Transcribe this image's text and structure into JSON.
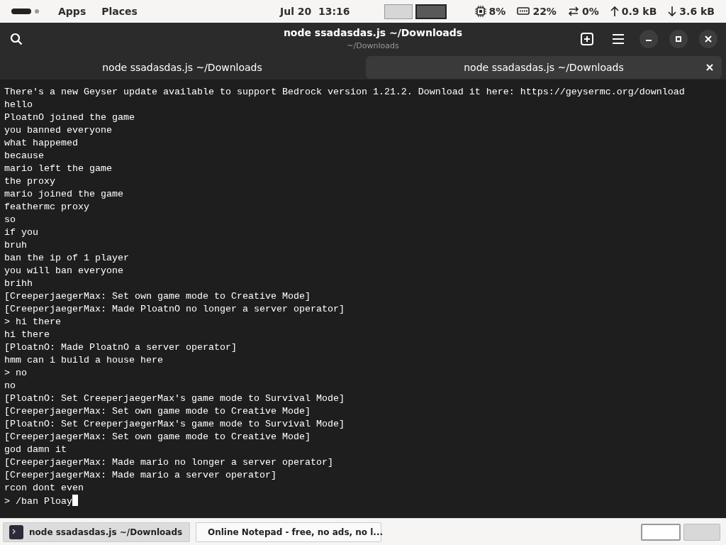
{
  "top_bar": {
    "menus": [
      "Apps",
      "Places"
    ],
    "clock": "Jul 20  13:16",
    "workspaces": [
      {
        "selected": false
      },
      {
        "selected": true
      }
    ],
    "indicators": [
      {
        "kind": "cpu",
        "text": "8%"
      },
      {
        "kind": "memory",
        "text": "22%"
      },
      {
        "kind": "swap",
        "text": "0%"
      },
      {
        "kind": "upload",
        "text": "0.9 kB"
      },
      {
        "kind": "download",
        "text": "3.6 kB"
      }
    ]
  },
  "window": {
    "title": "node ssadasdas.js ~/Downloads",
    "subtitle": "~/Downloads"
  },
  "tabs": [
    {
      "label": "node ssadasdas.js ~/Downloads",
      "selected": false
    },
    {
      "label": "node ssadasdas.js ~/Downloads",
      "selected": true
    }
  ],
  "terminal": {
    "lines": [
      "There's a new Geyser update available to support Bedrock version 1.21.2. Download it here: https://geysermc.org/download",
      "hello",
      "PloatnO joined the game",
      "you banned everyone",
      "what happemed",
      "because",
      "mario left the game",
      "the proxy",
      "mario joined the game",
      "feathermc proxy",
      "so",
      "if you",
      "bruh",
      "ban the ip of 1 player",
      "you will ban everyone",
      "brihh",
      "[CreeperjaegerMax: Set own game mode to Creative Mode]",
      "[CreeperjaegerMax: Made PloatnO no longer a server operator]",
      "> hi there",
      "hi there",
      "[PloatnO: Made PloatnO a server operator]",
      "hmm can i build a house here",
      "> no",
      "no",
      "[PloatnO: Set CreeperjaegerMax's game mode to Survival Mode]",
      "[CreeperjaegerMax: Set own game mode to Creative Mode]",
      "[PloatnO: Set CreeperjaegerMax's game mode to Survival Mode]",
      "[CreeperjaegerMax: Set own game mode to Creative Mode]",
      "god damn it",
      "[CreeperjaegerMax: Made mario no longer a server operator]",
      "[CreeperjaegerMax: Made mario a server operator]",
      "rcon dont even"
    ],
    "input": "> /ban Ploay"
  },
  "taskbar": {
    "windows": [
      {
        "kind": "terminal",
        "label": "node ssadasdas.js ~/Downloads",
        "selected": true
      },
      {
        "kind": "browser",
        "label": "Online Notepad - free, no ads, no l...",
        "selected": false
      }
    ],
    "workspaces": [
      {
        "selected": true
      },
      {
        "selected": false
      }
    ]
  }
}
